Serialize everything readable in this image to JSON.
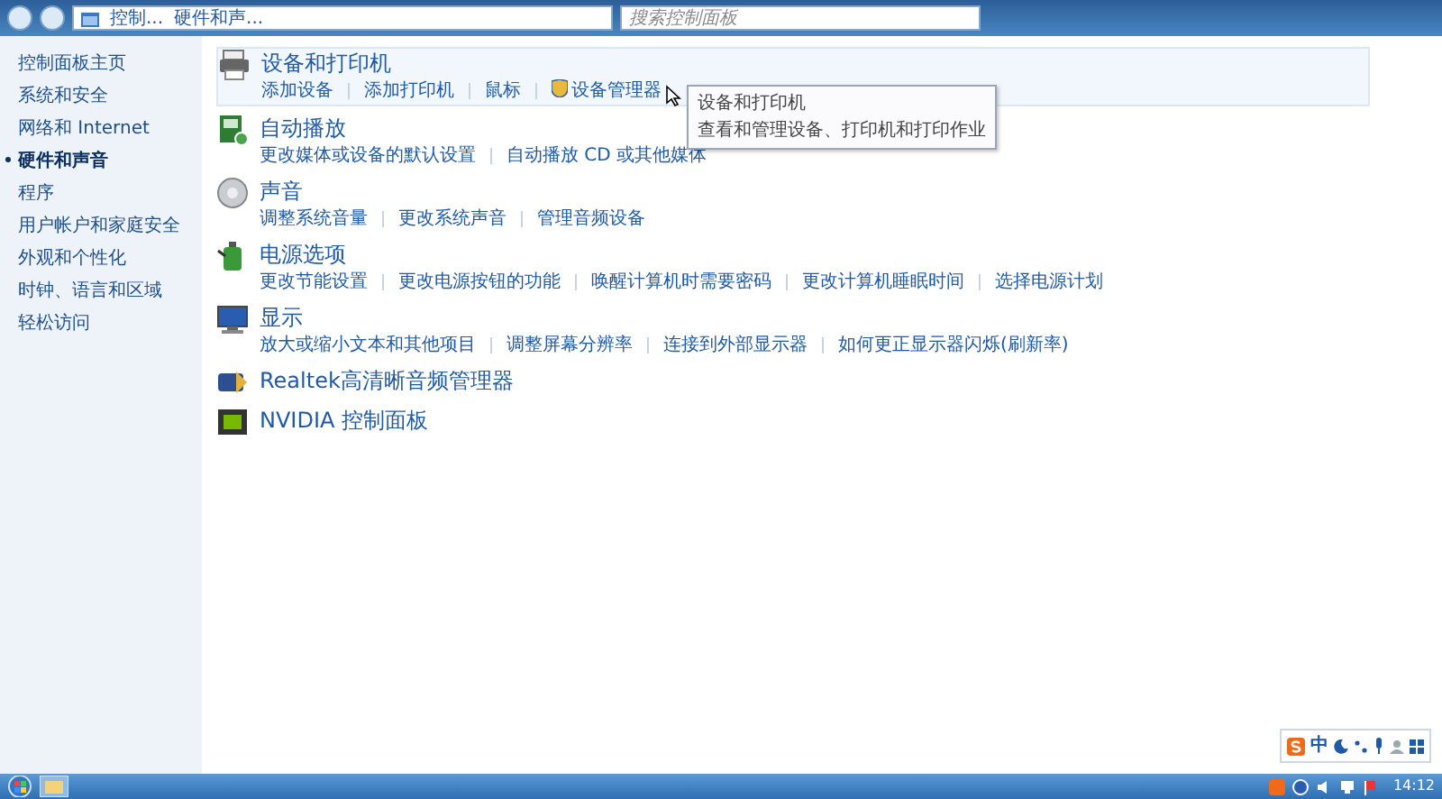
{
  "address_bar": {
    "breadcrumbs": [
      "控制...",
      "硬件和声..."
    ],
    "search": {
      "placeholder": "搜索控制面板"
    }
  },
  "sidebar": {
    "items": [
      {
        "label": "控制面板主页",
        "selected": false
      },
      {
        "label": "系统和安全",
        "selected": false
      },
      {
        "label": "网络和 Internet",
        "selected": false
      },
      {
        "label": "硬件和声音",
        "selected": true
      },
      {
        "label": "程序",
        "selected": false
      },
      {
        "label": "用户帐户和家庭安全",
        "selected": false
      },
      {
        "label": "外观和个性化",
        "selected": false
      },
      {
        "label": "时钟、语言和区域",
        "selected": false
      },
      {
        "label": "轻松访问",
        "selected": false
      }
    ]
  },
  "categories": [
    {
      "title": "设备和打印机",
      "links": [
        {
          "label": "添加设备",
          "shield": false
        },
        {
          "label": "添加打印机",
          "shield": false
        },
        {
          "label": "鼠标",
          "shield": false
        },
        {
          "label": "设备管理器",
          "shield": true
        }
      ]
    },
    {
      "title": "自动播放",
      "links": [
        {
          "label": "更改媒体或设备的默认设置",
          "shield": false
        },
        {
          "label": "自动播放 CD 或其他媒体",
          "shield": false
        }
      ]
    },
    {
      "title": "声音",
      "links": [
        {
          "label": "调整系统音量",
          "shield": false
        },
        {
          "label": "更改系统声音",
          "shield": false
        },
        {
          "label": "管理音频设备",
          "shield": false
        }
      ]
    },
    {
      "title": "电源选项",
      "links": [
        {
          "label": "更改节能设置",
          "shield": false
        },
        {
          "label": "更改电源按钮的功能",
          "shield": false
        },
        {
          "label": "唤醒计算机时需要密码",
          "shield": false
        },
        {
          "label": "更改计算机睡眠时间",
          "shield": false
        },
        {
          "label": "选择电源计划",
          "shield": false
        }
      ]
    },
    {
      "title": "显示",
      "links": [
        {
          "label": "放大或缩小文本和其他项目",
          "shield": false
        },
        {
          "label": "调整屏幕分辨率",
          "shield": false
        },
        {
          "label": "连接到外部显示器",
          "shield": false
        },
        {
          "label": "如何更正显示器闪烁(刷新率)",
          "shield": false
        }
      ]
    },
    {
      "title": "Realtek高清晰音频管理器"
    },
    {
      "title": "NVIDIA 控制面板"
    }
  ],
  "tooltip": {
    "title": "设备和打印机",
    "text": "查看和管理设备、打印机和打印作业"
  },
  "ime_toolbar": {
    "mode": "中"
  },
  "taskbar": {
    "clock": "14:12"
  }
}
